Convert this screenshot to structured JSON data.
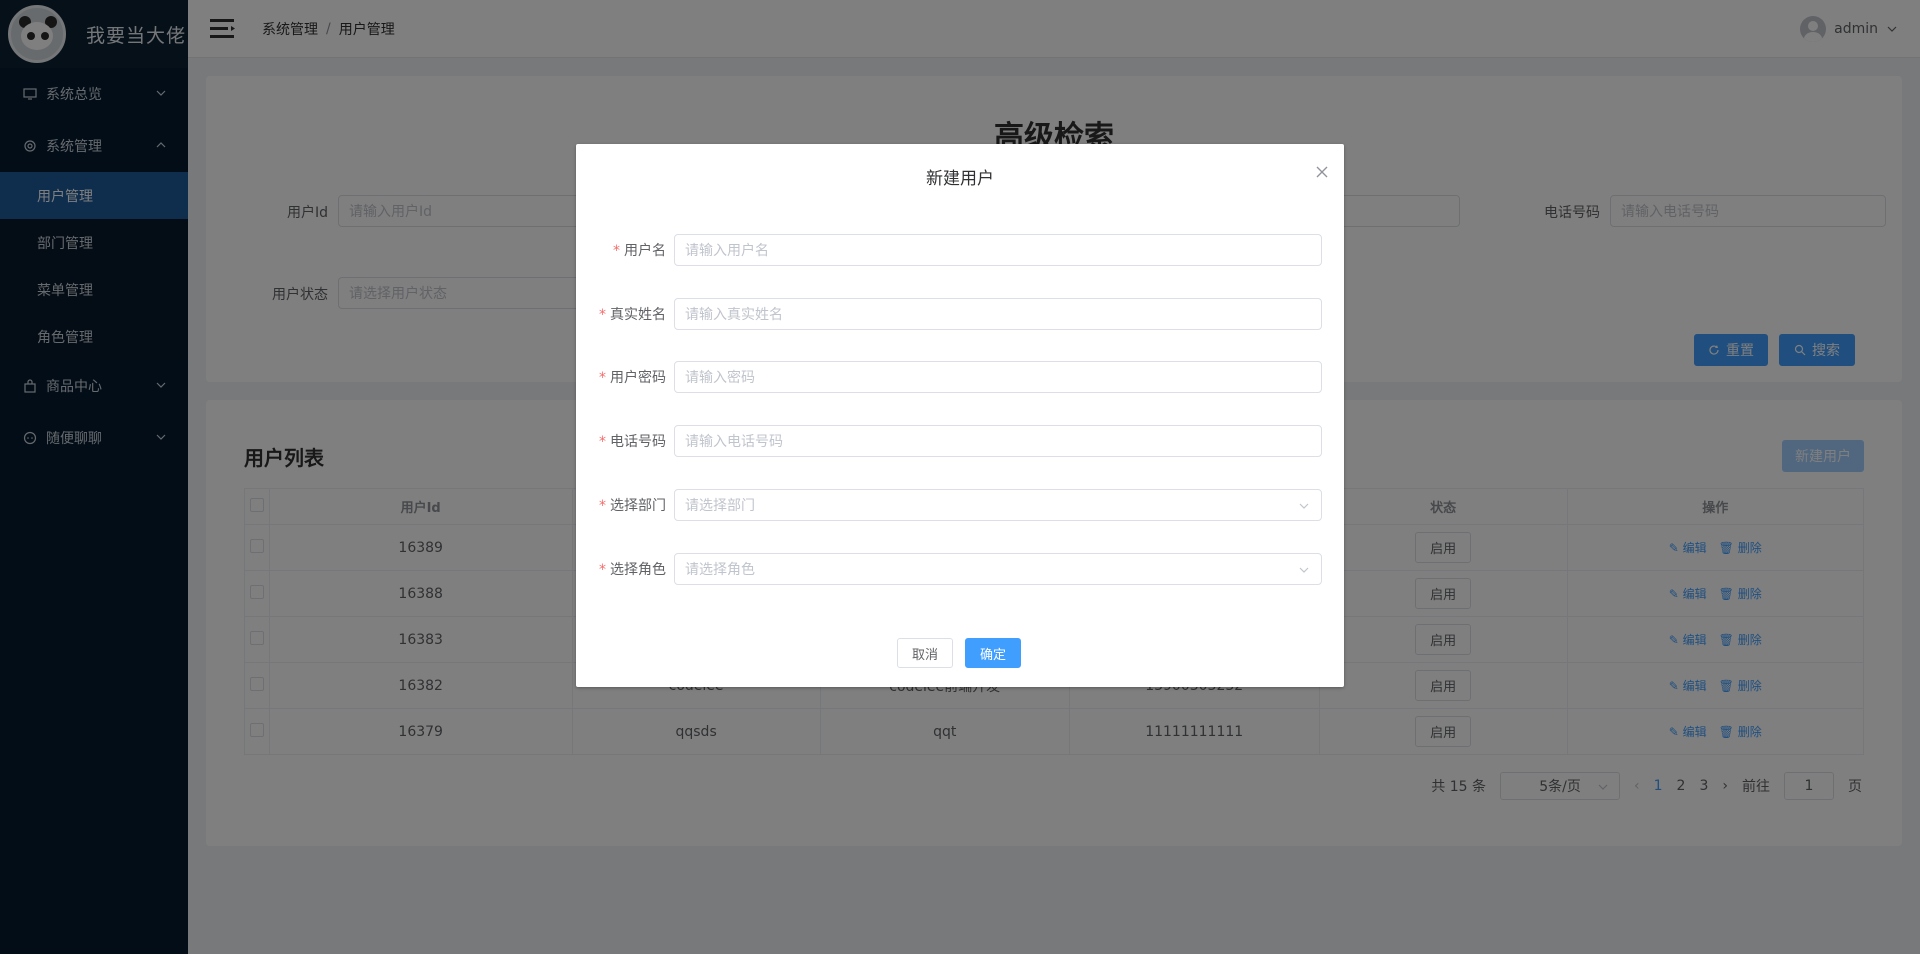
{
  "app": {
    "title": "我要当大佬"
  },
  "sidebar": {
    "items": [
      {
        "label": "系统总览",
        "icon": "monitor-icon",
        "expanded": false
      },
      {
        "label": "系统管理",
        "icon": "gear-icon",
        "expanded": true,
        "children": [
          "用户管理",
          "部门管理",
          "菜单管理",
          "角色管理"
        ],
        "active_child": "用户管理"
      },
      {
        "label": "商品中心",
        "icon": "shopping-bag-icon",
        "expanded": false
      },
      {
        "label": "随便聊聊",
        "icon": "chat-icon",
        "expanded": false
      }
    ]
  },
  "header": {
    "breadcrumb": [
      "系统管理",
      "用户管理"
    ],
    "breadcrumb_sep": "/",
    "username": "admin"
  },
  "search": {
    "title": "高级检索",
    "user_id_label": "用户Id",
    "user_id_placeholder": "请输入用户Id",
    "phone_label": "电话号码",
    "phone_placeholder": "请输入电话号码",
    "status_label": "用户状态",
    "status_placeholder": "请选择用户状态",
    "reset_label": "重置",
    "search_label": "搜索"
  },
  "list": {
    "title": "用户列表",
    "new_user_label": "新建用户",
    "columns": [
      "用户Id",
      "",
      "",
      "",
      "状态",
      "操作"
    ],
    "rows": [
      {
        "id": "16389",
        "c2": "",
        "c3": "",
        "c4": "",
        "status": "启用"
      },
      {
        "id": "16388",
        "c2": "",
        "c3": "",
        "c4": "",
        "status": "启用"
      },
      {
        "id": "16383",
        "c2": "",
        "c3": "",
        "c4": "",
        "status": "启用"
      },
      {
        "id": "16382",
        "c2": "codelee",
        "c3": "codelee前端开发",
        "c4": "13900303232",
        "status": "启用"
      },
      {
        "id": "16379",
        "c2": "qqsds",
        "c3": "qqt",
        "c4": "11111111111",
        "status": "启用"
      }
    ],
    "edit_label": "编辑",
    "delete_label": "删除"
  },
  "pager": {
    "total_text": "共 15 条",
    "page_size": "5条/页",
    "pages": [
      "1",
      "2",
      "3"
    ],
    "current_page": "1",
    "goto_label": "前往",
    "goto_value": "1",
    "page_suffix": "页"
  },
  "dialog": {
    "title": "新建用户",
    "fields": [
      {
        "label": "用户名",
        "placeholder": "请输入用户名",
        "type": "input"
      },
      {
        "label": "真实姓名",
        "placeholder": "请输入真实姓名",
        "type": "input"
      },
      {
        "label": "用户密码",
        "placeholder": "请输入密码",
        "type": "input"
      },
      {
        "label": "电话号码",
        "placeholder": "请输入电话号码",
        "type": "input"
      },
      {
        "label": "选择部门",
        "placeholder": "请选择部门",
        "type": "select"
      },
      {
        "label": "选择角色",
        "placeholder": "请选择角色",
        "type": "select"
      }
    ],
    "required_mark": "*",
    "cancel_label": "取消",
    "confirm_label": "确定"
  },
  "colors": {
    "sidebar_bg": "#071b30",
    "sidebar_active": "#1e5b9b",
    "primary": "#409eff",
    "required": "#f56c6c"
  }
}
